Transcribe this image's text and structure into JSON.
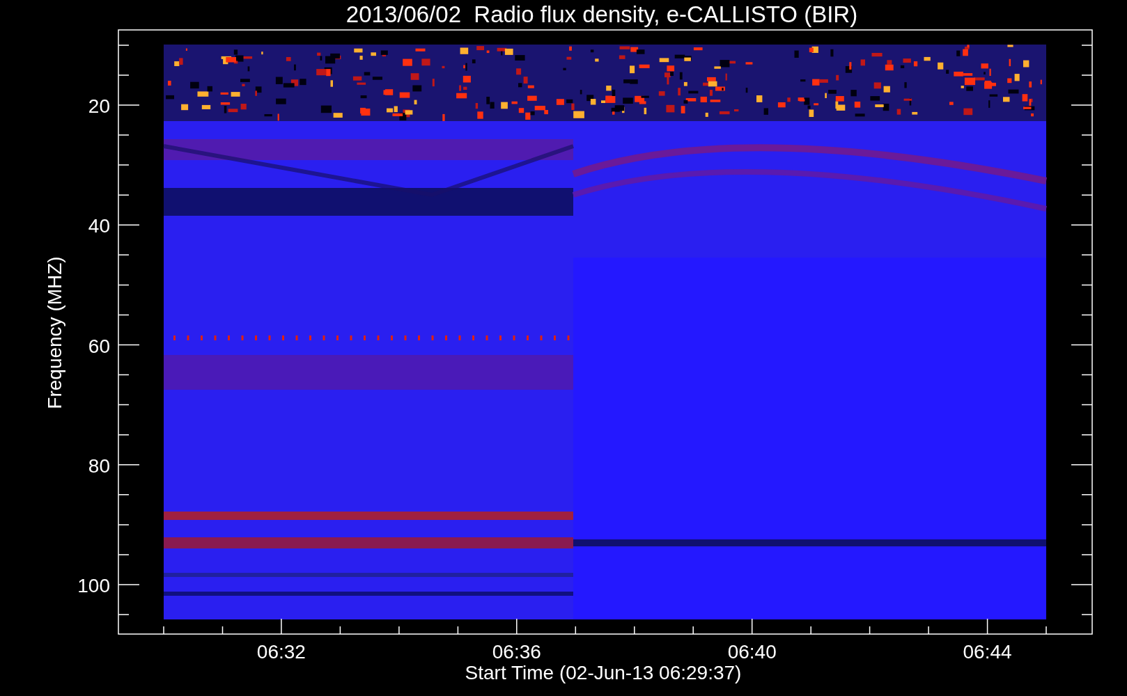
{
  "title": "2013/06/02  Radio flux density, e-CALLISTO (BIR)",
  "y_axis": {
    "label": "Frequency (MHZ)",
    "ticks": [
      "20",
      "40",
      "60",
      "80",
      "100"
    ]
  },
  "x_axis": {
    "label": "Start Time (02-Jun-13 06:29:37)",
    "ticks": [
      "06:32",
      "06:36",
      "06:40",
      "06:44"
    ]
  }
}
